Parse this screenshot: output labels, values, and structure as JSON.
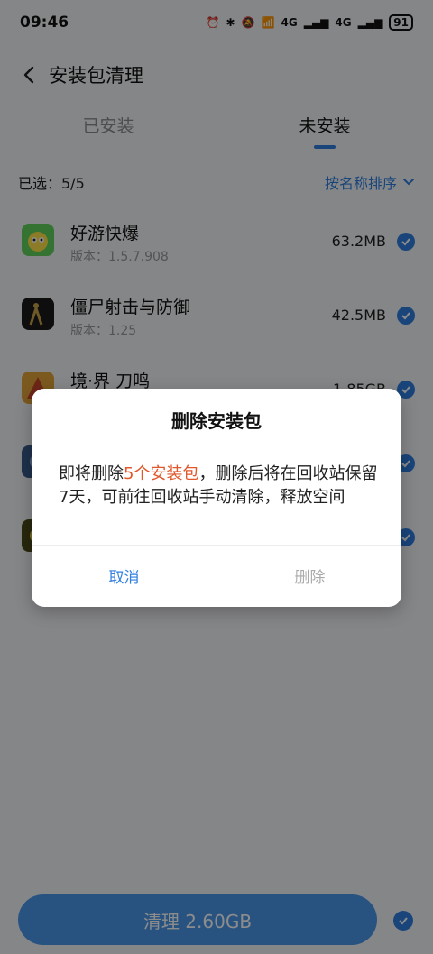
{
  "status": {
    "time": "09:46",
    "battery": "91",
    "net1": "4G",
    "net2": "4G"
  },
  "header": {
    "title": "安装包清理"
  },
  "tabs": [
    {
      "label": "已安装"
    },
    {
      "label": "未安装"
    }
  ],
  "summary": {
    "selected": "已选：5/5",
    "sort_label": "按名称排序"
  },
  "apps": [
    {
      "name": "好游快爆",
      "version": "版本：1.5.7.908",
      "size": "63.2MB"
    },
    {
      "name": "僵尸射击与防御",
      "version": "版本：1.25",
      "size": "42.5MB"
    },
    {
      "name": "境·界 刀鸣",
      "version": "",
      "size": "1.85GB"
    },
    {
      "name": "",
      "version": "",
      "size": ""
    },
    {
      "name": "",
      "version": "",
      "size": ""
    }
  ],
  "bottom": {
    "clean_label": "清理 2.60GB"
  },
  "dialog": {
    "title": "删除安装包",
    "message_prefix": "即将删除",
    "message_highlight": "5个安装包",
    "message_suffix": "，删除后将在回收站保留7天，可前往回收站手动清除，释放空间",
    "cancel_label": "取消",
    "delete_label": "删除"
  },
  "colors": {
    "accent": "#2f7ee0",
    "highlight": "#e0582b"
  }
}
